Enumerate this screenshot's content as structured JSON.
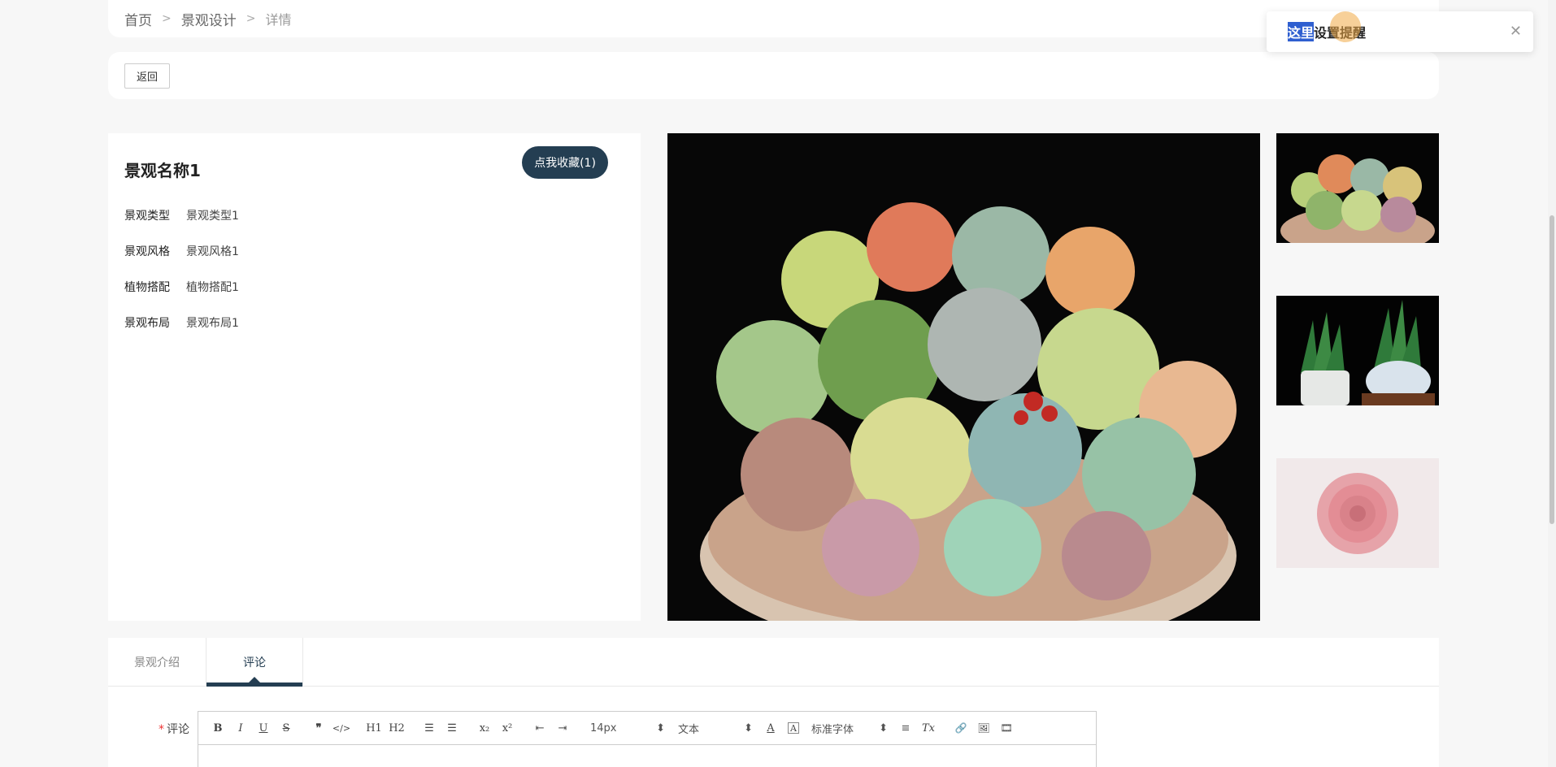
{
  "breadcrumb": {
    "home": "首页",
    "sep": ">",
    "section": "景观设计",
    "current": "详情"
  },
  "actions": {
    "back": "返回"
  },
  "detail": {
    "title": "景观名称1",
    "favorite": "点我收藏(1)",
    "attrs": [
      {
        "key": "景观类型",
        "value": "景观类型1"
      },
      {
        "key": "景观风格",
        "value": "景观风格1"
      },
      {
        "key": "植物搭配",
        "value": "植物搭配1"
      },
      {
        "key": "景观布局",
        "value": "景观布局1"
      }
    ]
  },
  "tabs": [
    {
      "label": "景观介绍"
    },
    {
      "label": "评论"
    }
  ],
  "comment": {
    "required_mark": "*",
    "label": "评论",
    "toolbar": {
      "bold": "B",
      "italic": "I",
      "underline": "U",
      "strike": "S",
      "quote": "❞",
      "code": "</>",
      "h1": "H1",
      "h2": "H2",
      "ordered_list": "☰",
      "bullet_list": "☰",
      "subscript": "x₂",
      "superscript": "x²",
      "outdent": "⇤",
      "indent": "⇥",
      "size": "14px",
      "format": "文本",
      "font": "标准字体",
      "color": "A",
      "background": "A",
      "align": "≡",
      "clean": "Tx",
      "link": "🔗",
      "image": "🖼",
      "video": "🎞",
      "arrows": "⬍"
    }
  },
  "toast": {
    "highlight": "这里",
    "text": "设置提醒",
    "close": "✕"
  },
  "colors": {
    "accent": "#243e52",
    "highlight": "#2f5fd0",
    "required": "#e33333"
  }
}
